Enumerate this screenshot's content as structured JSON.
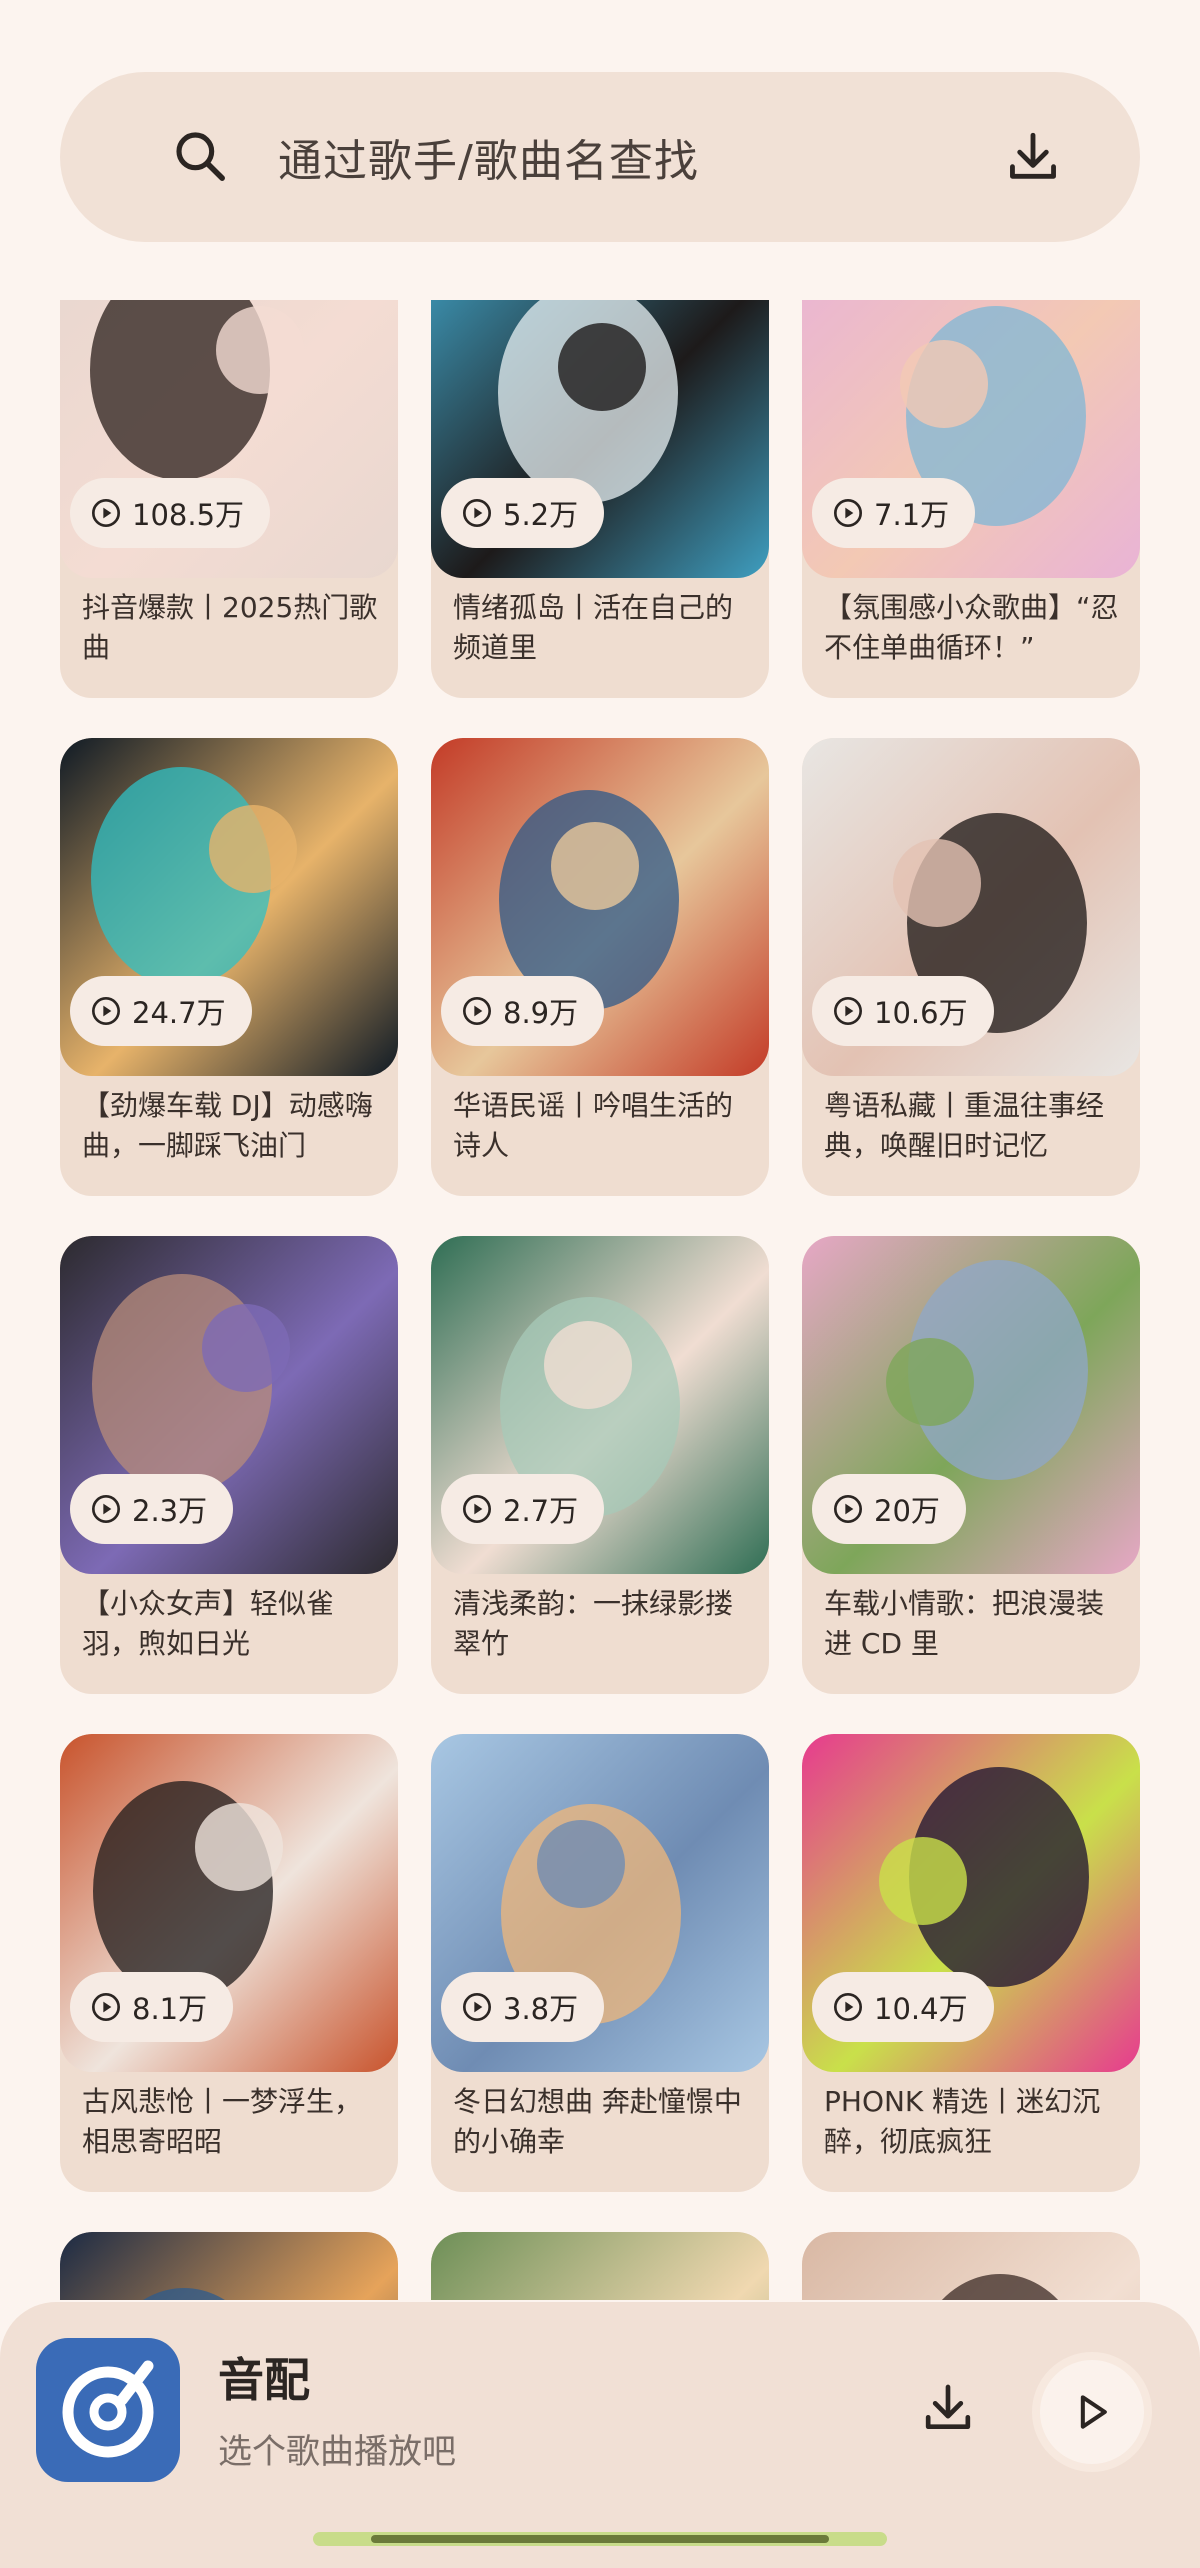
{
  "search": {
    "placeholder": "通过歌手/歌曲名查找"
  },
  "playlists": [
    {
      "plays": "108.5万",
      "title": "抖音爆款丨2025热门歌曲",
      "colors": [
        "#e8d7cf",
        "#2a1e1a",
        "#f4dcd3"
      ]
    },
    {
      "plays": "5.2万",
      "title": "情绪孤岛丨活在自己的频道里",
      "colors": [
        "#3f9fc1",
        "#e8f1f4",
        "#1d1a1a"
      ]
    },
    {
      "plays": "7.1万",
      "title": "【氛围感小众歌曲】“忍不住单曲循环！”",
      "colors": [
        "#e9b3d6",
        "#7fb7d6",
        "#f3c9b4"
      ]
    },
    {
      "plays": "24.7万",
      "title": "【劲爆车载 DJ】动感嗨曲，一脚踩飞油门",
      "colors": [
        "#0f1a25",
        "#2fc0c4",
        "#e7b36a"
      ]
    },
    {
      "plays": "8.9万",
      "title": "华语民谣丨吟唱生活的诗人",
      "colors": [
        "#c33b27",
        "#2e5a8a",
        "#e7c79b"
      ]
    },
    {
      "plays": "10.6万",
      "title": "粤语私藏丨重温往事经典，唤醒旧时记忆",
      "colors": [
        "#e8e6e3",
        "#1a1413",
        "#e3c2b3"
      ]
    },
    {
      "plays": "2.3万",
      "title": "【小众女声】轻似雀羽，煦如日光",
      "colors": [
        "#2c2a2e",
        "#b88c7b",
        "#7d6ab5"
      ]
    },
    {
      "plays": "2.7万",
      "title": "清浅柔韵：一抹绿影搂翠竹",
      "colors": [
        "#2f6e54",
        "#a7c9b8",
        "#f0ddd2"
      ]
    },
    {
      "plays": "20万",
      "title": "车载小情歌：把浪漫装进 CD 里",
      "colors": [
        "#e7a7c6",
        "#8fa7c9",
        "#7ea65a"
      ]
    },
    {
      "plays": "8.1万",
      "title": "古风悲怆丨一梦浮生，相思寄昭昭",
      "colors": [
        "#c8532c",
        "#1e1a1a",
        "#efe4dc"
      ]
    },
    {
      "plays": "3.8万",
      "title": "冬日幻想曲 奔赴憧憬中的小确幸",
      "colors": [
        "#a8c7e3",
        "#f0b77a",
        "#6f8cb3"
      ]
    },
    {
      "plays": "10.4万",
      "title": "PHONK 精选丨迷幻沉醉，彻底疯狂",
      "colors": [
        "#e73a8f",
        "#1a1030",
        "#c9e04a"
      ]
    },
    {
      "plays": "",
      "title": "",
      "colors": [
        "#1b2a44",
        "#2e5b8c",
        "#e6a35a"
      ]
    },
    {
      "plays": "",
      "title": "",
      "colors": [
        "#6d8f57",
        "#5a4a8a",
        "#f0d8b0"
      ]
    },
    {
      "plays": "",
      "title": "",
      "colors": [
        "#d9b8a4",
        "#3b2a24",
        "#f2dfd2"
      ]
    }
  ],
  "player": {
    "app_name": "音配",
    "subtitle": "选个歌曲播放吧"
  },
  "colors": {
    "background": "#fcf4ef",
    "card": "#efddd0",
    "accent_blue": "#3a6bb7"
  }
}
